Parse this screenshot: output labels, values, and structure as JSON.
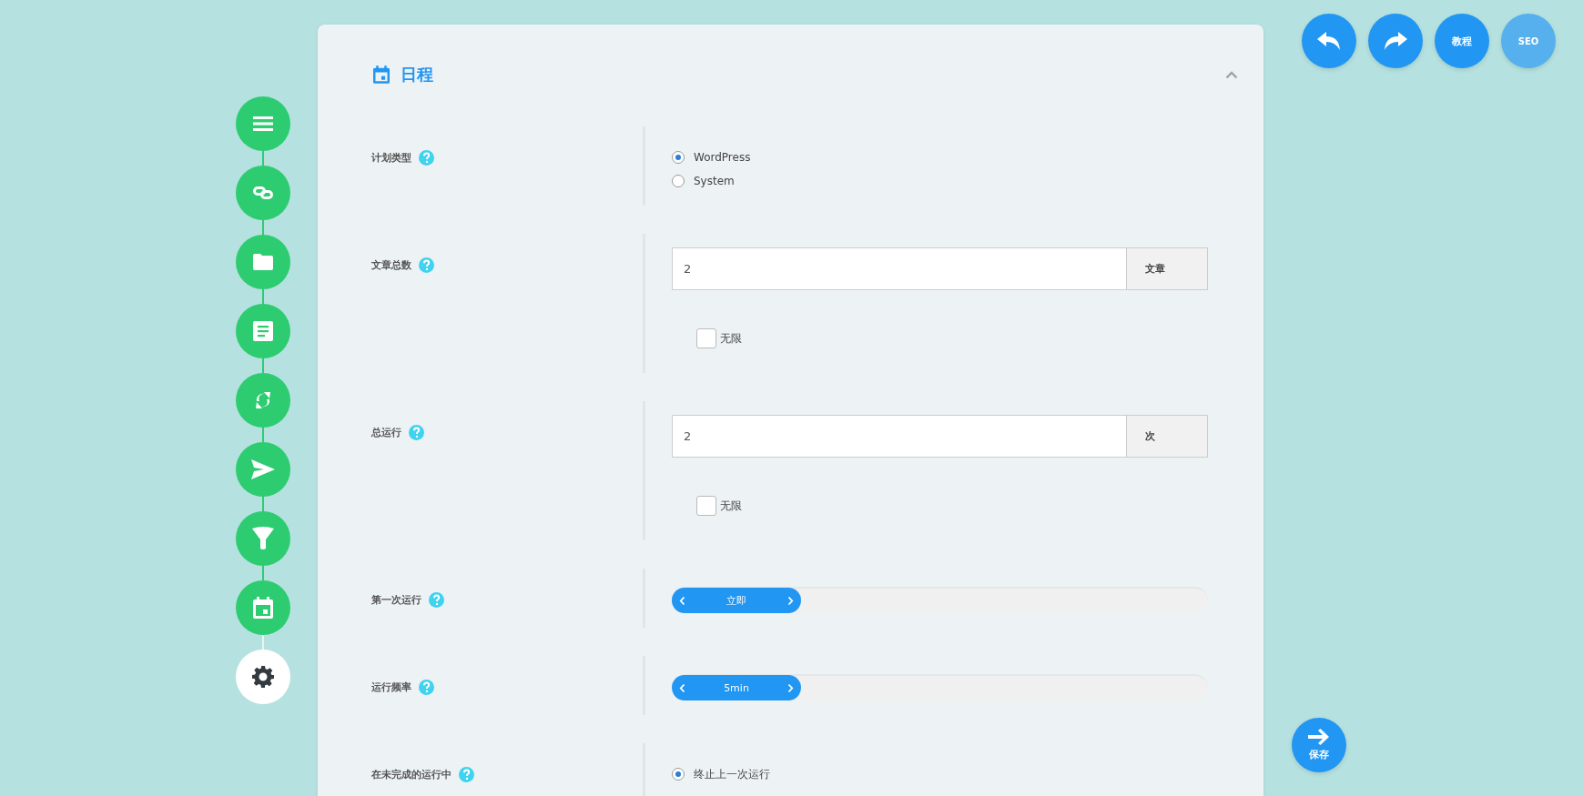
{
  "sidebar": {
    "items": [
      {
        "kind": "menu",
        "selected": false
      },
      {
        "kind": "link",
        "selected": false
      },
      {
        "kind": "folder",
        "selected": false
      },
      {
        "kind": "document",
        "selected": false
      },
      {
        "kind": "refresh",
        "selected": false
      },
      {
        "kind": "send",
        "selected": false
      },
      {
        "kind": "funnel",
        "selected": false
      },
      {
        "kind": "calendar",
        "selected": false
      },
      {
        "kind": "gear",
        "selected": true
      }
    ]
  },
  "toolbar": [
    {
      "kind": "undo"
    },
    {
      "kind": "redo"
    },
    {
      "kind": "text",
      "label": "教程",
      "disabled": false
    },
    {
      "kind": "text",
      "label": "SEO",
      "disabled": true
    }
  ],
  "section": {
    "title": "日程",
    "expanded": true,
    "fields": [
      {
        "kind": "radio",
        "label": "计划类型",
        "options": [
          {
            "label": "WordPress",
            "selected": true
          },
          {
            "label": "System",
            "selected": false
          }
        ]
      },
      {
        "kind": "number",
        "label": "文章总数",
        "value": "2",
        "unit": "文章",
        "checkbox": {
          "label": "无限",
          "checked": false
        }
      },
      {
        "kind": "number",
        "label": "总运行",
        "value": "2",
        "unit": "次",
        "checkbox": {
          "label": "无限",
          "checked": false
        }
      },
      {
        "kind": "stepper",
        "label": "第一次运行",
        "value": "立即"
      },
      {
        "kind": "stepper",
        "label": "运行频率",
        "value": "5min"
      },
      {
        "kind": "radio",
        "label": "在未完成的运行中",
        "options": [
          {
            "label": "终止上一次运行",
            "selected": true
          }
        ]
      }
    ]
  },
  "save_button": {
    "label": "保存"
  }
}
